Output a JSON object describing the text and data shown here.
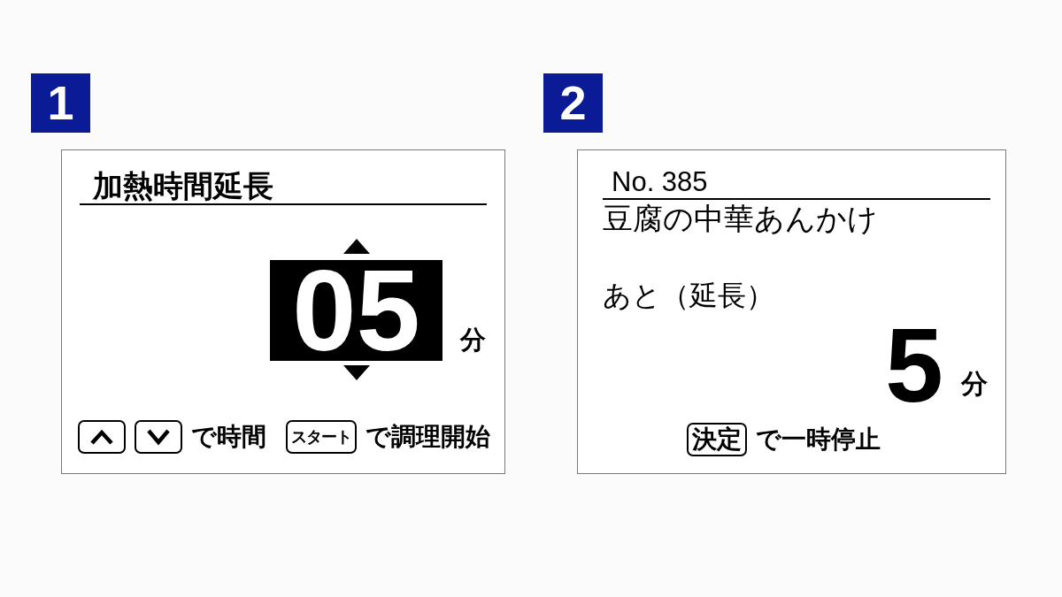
{
  "panels": [
    {
      "badge": "1",
      "kind": "time-setting",
      "title": "加熱時間延長",
      "value": "05",
      "unit": "分",
      "hint": [
        {
          "kind": "up-key"
        },
        {
          "kind": "down-key"
        },
        {
          "kind": "text",
          "text": "で時間"
        },
        {
          "kind": "key",
          "text": "スタート"
        },
        {
          "kind": "text",
          "text": "で調理開始"
        }
      ]
    },
    {
      "badge": "2",
      "kind": "cooking",
      "number": "No. 385",
      "title": "豆腐の中華あんかけ",
      "label": "あと（延長）",
      "value": "5",
      "unit": "分",
      "hint": [
        {
          "kind": "key",
          "text": "決定"
        },
        {
          "kind": "text",
          "text": "で一時停止"
        }
      ]
    }
  ]
}
